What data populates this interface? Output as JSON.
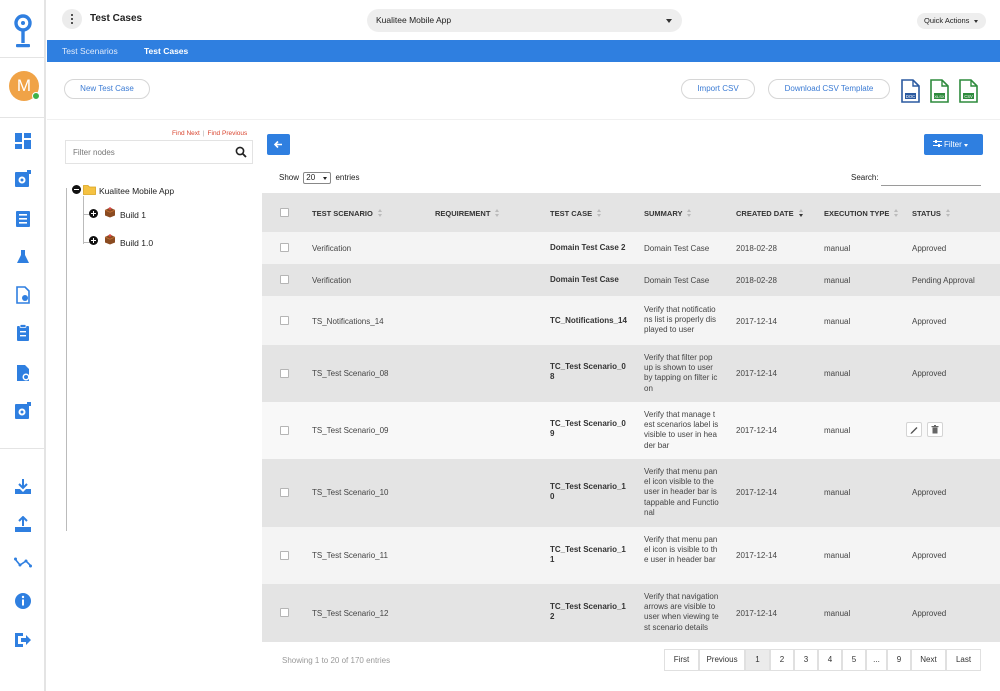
{
  "header": {
    "page_title": "Test Cases",
    "project": "Kualitee Mobile App",
    "quick_actions": "Quick Actions"
  },
  "user": {
    "avatar_letter": "M"
  },
  "tabs": [
    {
      "label": "Test Scenarios",
      "active": false
    },
    {
      "label": "Test Cases",
      "active": true
    }
  ],
  "toolbar": {
    "new_test_case": "New Test Case",
    "import_csv": "Import CSV",
    "download_template": "Download CSV Template",
    "export_icons": [
      "DOC",
      "XLSX",
      "CSV"
    ]
  },
  "tree": {
    "find_next": "Find Next",
    "find_previous": "Find Previous",
    "filter_placeholder": "Filter nodes",
    "root": "Kualitee Mobile App",
    "children": [
      "Build 1",
      "Build 1.0"
    ]
  },
  "table_controls": {
    "show": "Show",
    "entries_value": "20",
    "entries": "entries",
    "search_label": "Search:",
    "filter_button": "Filter"
  },
  "table": {
    "columns": [
      "TEST SCENARIO",
      "REQUIREMENT",
      "TEST CASE",
      "SUMMARY",
      "CREATED DATE",
      "EXECUTION TYPE",
      "STATUS"
    ],
    "rows": [
      {
        "scenario": "Verification",
        "requirement": "",
        "test_case": "Domain Test Case 2",
        "summary": "Domain Test Case",
        "date": "2018-02-28",
        "type": "manual",
        "status": "Approved"
      },
      {
        "scenario": "Verification",
        "requirement": "",
        "test_case": "Domain Test Case",
        "summary": "Domain Test Case",
        "date": "2018-02-28",
        "type": "manual",
        "status": "Pending Approval"
      },
      {
        "scenario": "TS_Notifications_14",
        "requirement": "",
        "test_case": "TC_Notifications_14",
        "summary": "Verify that notifications list is properly displayed to user",
        "date": "2017-12-14",
        "type": "manual",
        "status": "Approved"
      },
      {
        "scenario": "TS_Test Scenario_08",
        "requirement": "",
        "test_case": "TC_Test Scenario_08",
        "summary": "Verify that filter pop up is shown to user by tapping on filter icon",
        "date": "2017-12-14",
        "type": "manual",
        "status": "Approved"
      },
      {
        "scenario": "TS_Test Scenario_09",
        "requirement": "",
        "test_case": "TC_Test Scenario_09",
        "summary": "Verify that manage test scenarios label is visible to user in header bar",
        "date": "2017-12-14",
        "type": "manual",
        "status": ""
      },
      {
        "scenario": "TS_Test Scenario_10",
        "requirement": "",
        "test_case": "TC_Test Scenario_10",
        "summary": "Verify that menu panel icon visible to the user in header bar is tappable and Functional",
        "date": "2017-12-14",
        "type": "manual",
        "status": "Approved"
      },
      {
        "scenario": "TS_Test Scenario_11",
        "requirement": "",
        "test_case": "TC_Test Scenario_11",
        "summary": "Verify that menu panel icon is visible to the user in header bar",
        "date": "2017-12-14",
        "type": "manual",
        "status": "Approved"
      },
      {
        "scenario": "TS_Test Scenario_12",
        "requirement": "",
        "test_case": "TC_Test Scenario_12",
        "summary": "Verify that navigation arrows are visible to user when viewing test scenario details",
        "date": "2017-12-14",
        "type": "manual",
        "status": "Approved"
      }
    ]
  },
  "footer": {
    "showing": "Showing 1 to 20 of 170 entries",
    "pages": [
      "First",
      "Previous",
      "1",
      "2",
      "3",
      "4",
      "5",
      "...",
      "9",
      "Next",
      "Last"
    ],
    "active_page": "1"
  },
  "colors": {
    "primary": "#2f7fe0",
    "avatar": "#f0a347",
    "online": "#3fb24a",
    "link_red": "#d9452f"
  }
}
